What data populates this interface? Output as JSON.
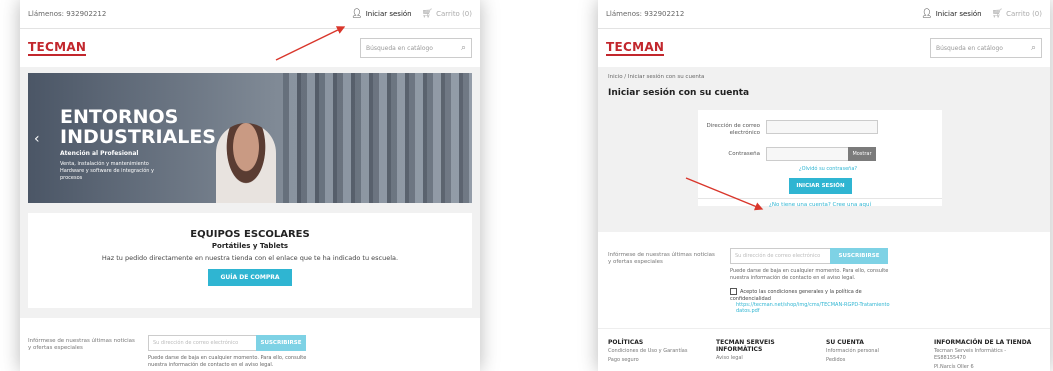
{
  "left": {
    "topbar": {
      "phone": "Llámenos: 932902212",
      "login": "Iniciar sesión",
      "cart": "Carrito (0)"
    },
    "logo": "TECMAN",
    "search_placeholder": "Búsqueda en catálogo",
    "banner": {
      "title_line1": "ENTORNOS",
      "title_line2": "INDUSTRIALES",
      "subtitle": "Atención al Profesional",
      "desc": "Venta, instalación y mantenimiento Hardware y software de integración y procesos"
    },
    "promo": {
      "title": "EQUIPOS ESCOLARES",
      "subtitle": "Portátiles y Tablets",
      "text": "Haz tu pedido directamente en nuestra tienda con el enlace que te ha indicado tu escuela.",
      "button": "GUÍA DE COMPRA"
    },
    "newsletter": {
      "label": "Infórmese de nuestras últimas noticias y ofertas especiales",
      "placeholder": "Su dirección de correo electrónico",
      "button": "SUSCRIBIRSE",
      "note": "Puede darse de baja en cualquier momento. Para ello, consulte nuestra información de contacto en el aviso legal."
    }
  },
  "right": {
    "topbar": {
      "phone": "Llámenos: 932902212",
      "login": "Iniciar sesión",
      "cart": "Carrito (0)"
    },
    "logo": "TECMAN",
    "search_placeholder": "Búsqueda en catálogo",
    "breadcrumb": "Inicio / Iniciar sesión con su cuenta",
    "page_title": "Iniciar sesión con su cuenta",
    "form": {
      "email_label": "Dirección de correo electrónico",
      "password_label": "Contraseña",
      "show_button": "Mostrar",
      "forgot": "¿Olvidó su contraseña?",
      "signin_button": "INICIAR SESIÓN",
      "no_account": "¿No tiene una cuenta? Cree una aquí"
    },
    "newsletter": {
      "label": "Infórmese de nuestras últimas noticias y ofertas especiales",
      "placeholder": "Su dirección de correo electrónico",
      "button": "SUSCRIBIRSE",
      "note": "Puede darse de baja en cualquier momento. Para ello, consulte nuestra información de contacto en el aviso legal.",
      "consent": "Acepto las condiciones generales y la política de confidencialidad",
      "link": "https://tecman.net/shop/img/cms/TECMAN-RGPD-Tratamiento datos.pdf"
    },
    "footer": {
      "col1": {
        "heading": "POLÍTICAS",
        "links": [
          "Condiciones de Uso y Garantías",
          "Pago seguro"
        ]
      },
      "col2": {
        "heading": "TECMAN SERVEIS INFORMÀTICS",
        "links": [
          "Aviso legal"
        ]
      },
      "col3": {
        "heading": "SU CUENTA",
        "links": [
          "Información personal",
          "Pedidos"
        ]
      },
      "col4": {
        "heading": "INFORMACIÓN DE LA TIENDA",
        "links": [
          "Tecman Serveis Informàtics - ES88155470",
          "Pl.Narcís Oller 6"
        ]
      }
    }
  },
  "colors": {
    "brand_red": "#c2272d",
    "accent": "#2fb5d2",
    "annotation_arrow": "#d9362b"
  }
}
